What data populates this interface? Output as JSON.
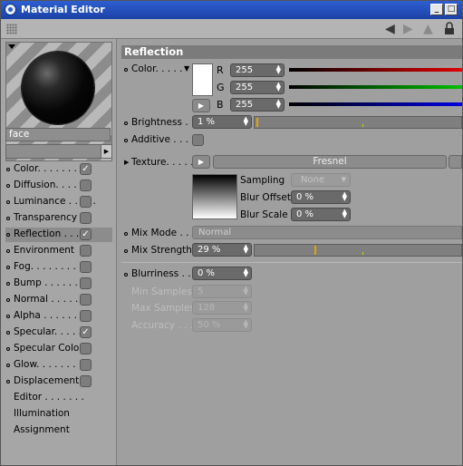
{
  "window": {
    "title": "Material Editor"
  },
  "toolbar": {
    "icons": [
      "grip-icon",
      "back-arrow-icon",
      "forward-arrow-icon",
      "up-arrow-icon",
      "lock-icon"
    ]
  },
  "material": {
    "name": "face"
  },
  "channels": [
    {
      "label": "Color. . . . . . . .",
      "checked": true,
      "has_checkbox": true,
      "has_dot": true
    },
    {
      "label": "Diffusion. . . . . .",
      "checked": false,
      "has_checkbox": true,
      "has_dot": true
    },
    {
      "label": "Luminance . . . . .",
      "checked": false,
      "has_checkbox": true,
      "has_dot": true
    },
    {
      "label": "Transparency",
      "checked": false,
      "has_checkbox": true,
      "has_dot": true
    },
    {
      "label": "Reflection . . . . .",
      "checked": true,
      "has_checkbox": true,
      "has_dot": true,
      "active": true
    },
    {
      "label": "Environment",
      "checked": false,
      "has_checkbox": true,
      "has_dot": true
    },
    {
      "label": "Fog. . . . . . . . . .",
      "checked": false,
      "has_checkbox": true,
      "has_dot": true
    },
    {
      "label": "Bump . . . . . . . .",
      "checked": false,
      "has_checkbox": true,
      "has_dot": true
    },
    {
      "label": "Normal . . . . . . .",
      "checked": false,
      "has_checkbox": true,
      "has_dot": true
    },
    {
      "label": "Alpha . . . . . . . .",
      "checked": false,
      "has_checkbox": true,
      "has_dot": true
    },
    {
      "label": "Specular. . . . . .",
      "checked": true,
      "has_checkbox": true,
      "has_dot": true
    },
    {
      "label": "Specular Color",
      "checked": false,
      "has_checkbox": true,
      "has_dot": true
    },
    {
      "label": "Glow. . . . . . . . .",
      "checked": false,
      "has_checkbox": true,
      "has_dot": true
    },
    {
      "label": "Displacement",
      "checked": false,
      "has_checkbox": true,
      "has_dot": true
    },
    {
      "label": "Editor . . . . . . .",
      "checked": false,
      "has_checkbox": false,
      "has_dot": false
    },
    {
      "label": "Illumination",
      "checked": false,
      "has_checkbox": false,
      "has_dot": false
    },
    {
      "label": "Assignment",
      "checked": false,
      "has_checkbox": false,
      "has_dot": false
    }
  ],
  "section": {
    "title": "Reflection"
  },
  "color": {
    "label": "Color. . . . .",
    "swatch": "#ffffff",
    "r_label": "R",
    "r_value": "255",
    "g_label": "G",
    "g_value": "255",
    "b_label": "B",
    "b_value": "255"
  },
  "brightness": {
    "label": "Brightness . .",
    "value": "1 %",
    "level": 0.01
  },
  "additive": {
    "label": "Additive . . . .",
    "checked": false
  },
  "texture": {
    "label": "Texture. . . . .",
    "shader": "Fresnel",
    "sampling_label": "Sampling",
    "sampling_value": "None",
    "blur_offset_label": "Blur Offset",
    "blur_offset_value": "0 %",
    "blur_scale_label": "Blur Scale",
    "blur_scale_value": "0 %"
  },
  "mix_mode": {
    "label": "Mix Mode . . .",
    "value": "Normal"
  },
  "mix_strength": {
    "label": "Mix Strength",
    "value": "29 %",
    "level": 0.29
  },
  "blurriness": {
    "label": "Blurriness . . .",
    "value": "0 %"
  },
  "min_samples": {
    "label": "Min Samples",
    "value": "5"
  },
  "max_samples": {
    "label": "Max Samples",
    "value": "128"
  },
  "accuracy": {
    "label": "Accuracy . . .",
    "value": "50 %"
  },
  "colors": {
    "title_bar": "#2150c0",
    "panel": "#9f9f9f",
    "indicator": "#e8a300"
  }
}
